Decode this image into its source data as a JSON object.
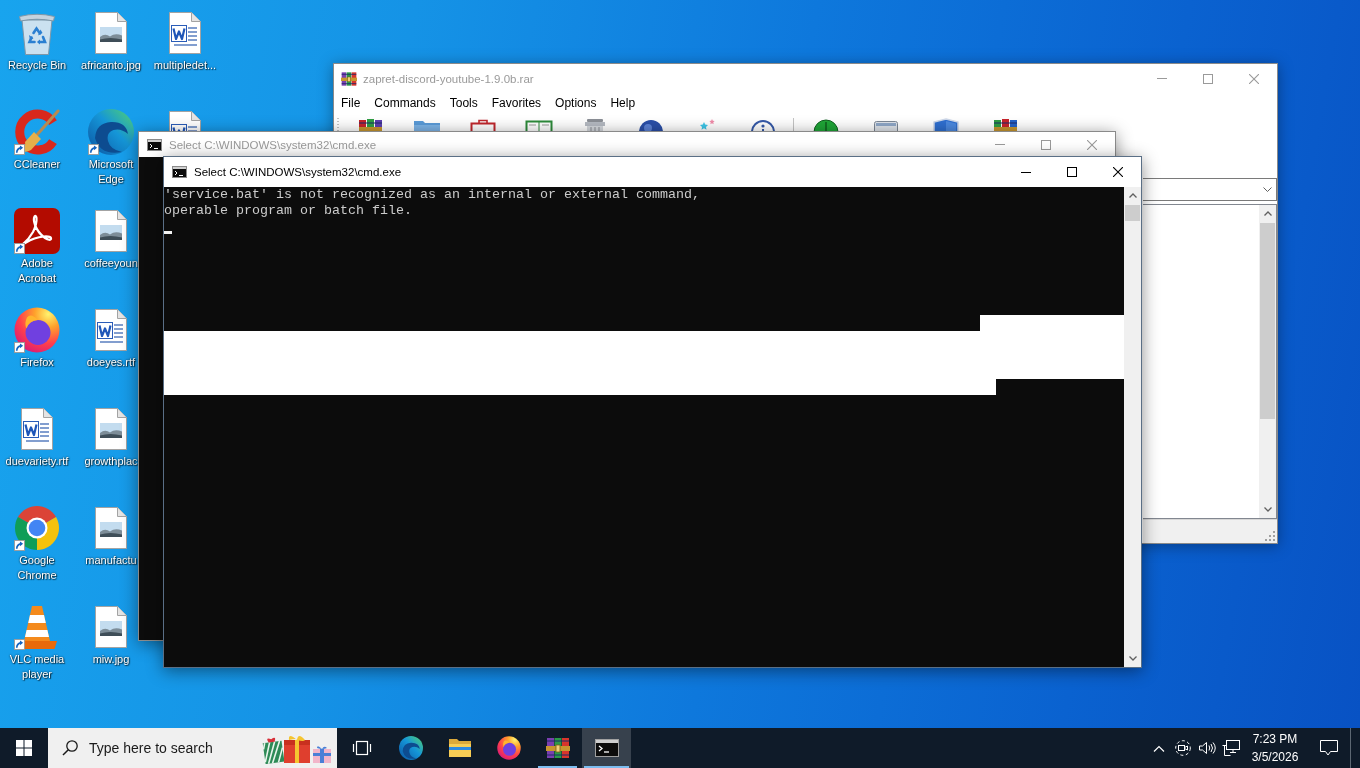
{
  "desktop": {
    "icons": [
      {
        "kind": "bin",
        "label": "Recycle Bin",
        "shortcut": false
      },
      {
        "kind": "ccleaner",
        "label": "CCleaner",
        "shortcut": true
      },
      {
        "kind": "acrobat",
        "label": "Adobe Acrobat",
        "shortcut": true
      },
      {
        "kind": "firefox",
        "label": "Firefox",
        "shortcut": true
      },
      {
        "kind": "word",
        "label": "duevariety.rtf",
        "shortcut": false
      },
      {
        "kind": "chrome",
        "label": "Google Chrome",
        "shortcut": true
      },
      {
        "kind": "vlc",
        "label": "VLC media player",
        "shortcut": true
      },
      {
        "kind": "image",
        "label": "africanto.jpg",
        "shortcut": false
      },
      {
        "kind": "edge",
        "label": "Microsoft Edge",
        "shortcut": true
      },
      {
        "kind": "image",
        "label": "coffeeyoun",
        "shortcut": false
      },
      {
        "kind": "word",
        "label": "doeyes.rtf",
        "shortcut": false
      },
      {
        "kind": "image",
        "label": "growthplac",
        "shortcut": false
      },
      {
        "kind": "image",
        "label": "manufactu",
        "shortcut": false
      },
      {
        "kind": "image",
        "label": "miw.jpg",
        "shortcut": false
      },
      {
        "kind": "word",
        "label": "multipledet...",
        "shortcut": false
      },
      {
        "kind": "word",
        "shortcut": false
      }
    ]
  },
  "archive_window": {
    "title": "zapret-discord-youtube-1.9.0b.rar",
    "active": false,
    "menu": [
      "File",
      "Commands",
      "Tools",
      "Favorites",
      "Options",
      "Help"
    ]
  },
  "console_windows": [
    {
      "title": "Select C:\\WINDOWS\\system32\\cmd.exe",
      "active": false
    },
    {
      "title": "Select C:\\WINDOWS\\system32\\cmd.exe",
      "active": true,
      "lines": [
        "'service.bat' is not recognized as an internal or external command,",
        "operable program or batch file."
      ],
      "cursor": true,
      "selection": true
    }
  ],
  "taskbar": {
    "search": {
      "placeholder": "Type here to search"
    },
    "apps": [
      {
        "kind": "taskview",
        "running": false,
        "selected": false
      },
      {
        "kind": "edge",
        "running": false,
        "selected": false
      },
      {
        "kind": "explorer",
        "running": false,
        "selected": false
      },
      {
        "kind": "firefox",
        "running": false,
        "selected": false
      },
      {
        "kind": "winrar",
        "running": true,
        "selected": false
      },
      {
        "kind": "cmd",
        "running": true,
        "selected": true
      }
    ],
    "clock": {
      "time": "7:23 PM",
      "date": "3/5/2026"
    }
  }
}
